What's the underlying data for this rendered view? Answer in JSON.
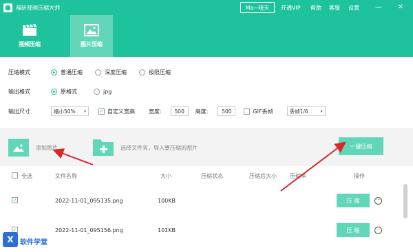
{
  "titlebar": {
    "app_title": "福昕视频压缩大师",
    "user": "Ma~晓天",
    "links": [
      "开通VIP",
      "帮助",
      "客服",
      "设置"
    ]
  },
  "tabs": [
    {
      "label": "视频压缩",
      "active": false
    },
    {
      "label": "图片压缩",
      "active": true
    }
  ],
  "options": {
    "mode": {
      "label": "压缩模式",
      "choices": [
        "普通压缩",
        "深度压缩",
        "极限压缩"
      ],
      "selected": "普通压缩"
    },
    "format": {
      "label": "输出格式",
      "choices": [
        "原格式",
        "jpg"
      ],
      "selected": "原格式"
    },
    "size": {
      "label": "输出尺寸",
      "scale_value": "缩小50%",
      "custom_label": "自定义宽高",
      "custom_checked": true,
      "width_label": "宽度:",
      "width_value": "500",
      "height_label": "高度:",
      "height_value": "500",
      "gif_label": "GIF丢帧",
      "gif_checked": false,
      "drop_value": "丢帧1/6"
    }
  },
  "actions": {
    "add_image": "添加图片",
    "folder_hint": "选择文件夹，导入要压缩的图片",
    "compress_all": "一键压缩"
  },
  "table": {
    "select_all": "全选",
    "headers": [
      "文件名称",
      "大小",
      "压缩状态",
      "压缩后大小",
      "压缩率",
      "操作"
    ],
    "rows": [
      {
        "name": "2022-11-01_095135.png",
        "size": "100KB",
        "checked": true,
        "action": "压 缩"
      },
      {
        "name": "2022-11-01_095156.png",
        "size": "101KB",
        "checked": true,
        "action": "压 缩"
      }
    ]
  },
  "watermark": {
    "text": "软件学堂",
    "logo_char": "X"
  },
  "colors": {
    "brand": "#1ec39d",
    "brand_light": "#62d6b9",
    "arrow": "#d8262b"
  },
  "icons": {
    "app": "app-logo-icon",
    "video_tab": "film-clapper-icon",
    "image_tab": "picture-icon",
    "folder": "folder-plus-icon",
    "more": "more-options-icon"
  }
}
